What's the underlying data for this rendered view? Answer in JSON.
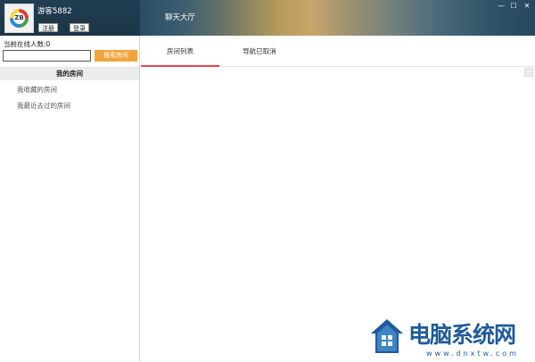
{
  "titlebar": {
    "username": "游客5882",
    "register_label": "注册",
    "login_label": "登录",
    "lobby_title": "聊天大厅",
    "avatar_text": "ZB",
    "window_controls": {
      "minimize": "—",
      "maximize": "☐",
      "close": "✕"
    }
  },
  "sidebar": {
    "online_label": "当前在线人数:0",
    "search_input_value": "",
    "search_button_label": "搜索房间",
    "items": [
      {
        "label": "我的房间",
        "active": true
      },
      {
        "label": "我收藏的房间",
        "active": false
      },
      {
        "label": "我最近去过的房间",
        "active": false
      }
    ]
  },
  "main": {
    "tabs": [
      {
        "label": "房间列表",
        "active": true
      },
      {
        "label": "导航已取消",
        "active": false
      }
    ]
  },
  "watermark": {
    "text": "电脑系统网",
    "url": "www.dnxtw.com"
  },
  "colors": {
    "accent_orange": "#f3a33a",
    "tab_underline": "#e8454b",
    "titlebar_dark": "#1f3a4f",
    "watermark_blue": "#1f5b9a"
  }
}
